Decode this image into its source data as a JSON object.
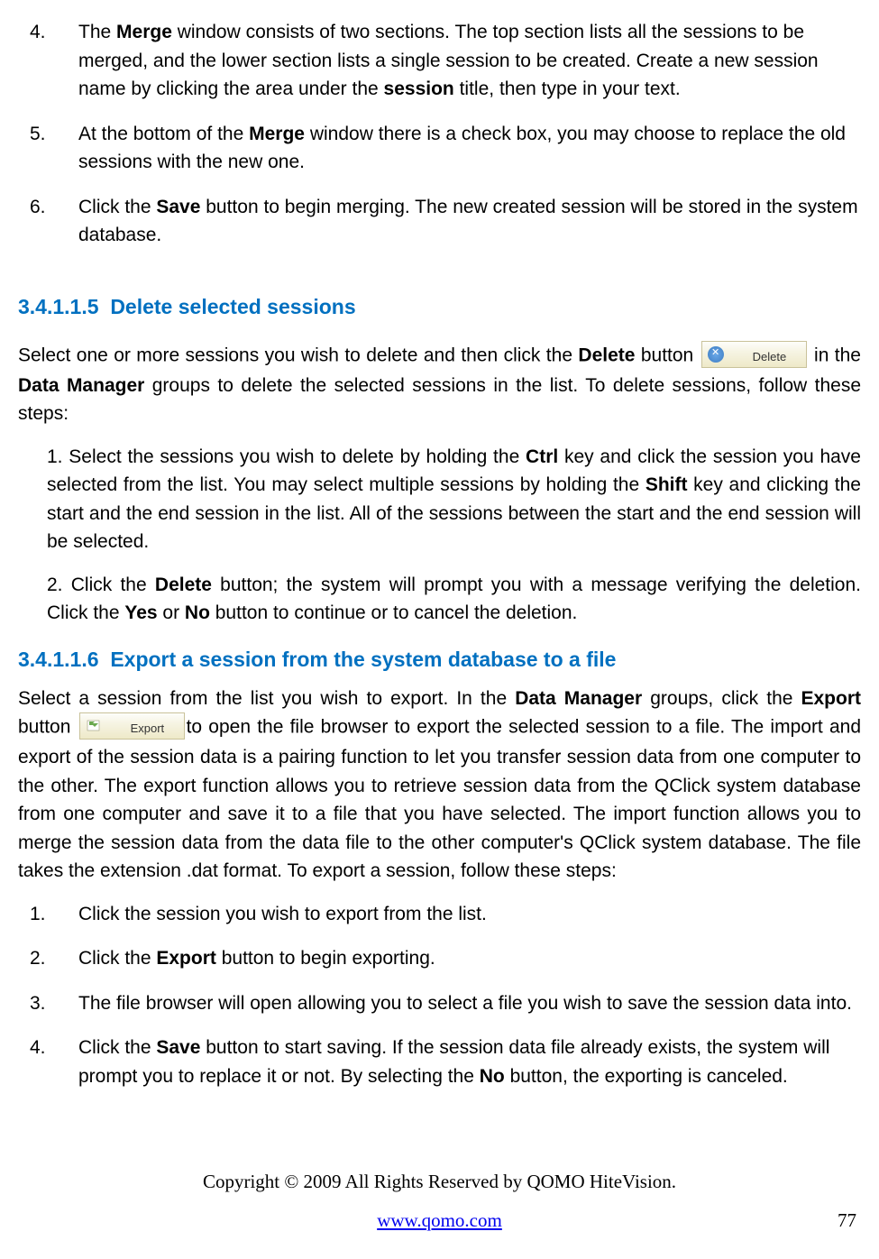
{
  "topList": {
    "items": [
      {
        "num": "4.",
        "pre": "The ",
        "bold1": "Merge",
        "mid": " window consists of two sections. The top section lists all the sessions to be merged, and the lower section lists a single session to be created. Create a new session name by clicking the area under the ",
        "bold2": "session",
        "post": " title, then type in your text."
      },
      {
        "num": "5.",
        "pre": "At the bottom of the ",
        "bold1": "Merge",
        "post": " window there is a check box, you may choose to replace the old sessions with the new one."
      },
      {
        "num": "6.",
        "pre": "Click the ",
        "bold1": "Save",
        "post": " button to begin merging. The new created session will be stored in the system database."
      }
    ]
  },
  "section1": {
    "num": "3.4.1.1.5",
    "title": "Delete selected sessions",
    "intro": {
      "pre": "Select one or more sessions you wish to delete and then click the ",
      "bold1": "Delete",
      "mid1": " button ",
      "btnLabel": "Delete",
      "mid2": " in the ",
      "bold2": "Data Manager",
      "post": " groups to delete the selected sessions in the list. To delete sessions, follow these steps:"
    },
    "step1": {
      "num": "1. ",
      "t1": "Select the sessions you wish to delete by holding the ",
      "b1": "Ctrl",
      "t2": " key and click the session you have selected from the list. You may select multiple sessions by holding the ",
      "b2": "Shift",
      "t3": " key and clicking the start and the end session in the list. All of the sessions between the start and the end session will be selected."
    },
    "step2": {
      "num": "2. ",
      "t1": "Click the ",
      "b1": "Delete",
      "t2": " button; the system will prompt you with a message verifying the deletion. Click the ",
      "b2": "Yes",
      "t3": " or ",
      "b3": "No",
      "t4": " button to continue or to cancel the deletion."
    }
  },
  "section2": {
    "num": "3.4.1.1.6",
    "title": "Export a session from the system database to a file",
    "intro": {
      "t1": "Select a session from the list you wish to export. In the ",
      "b1": "Data Manager",
      "t2": " groups, click the ",
      "b2": "Export",
      "t3": " button ",
      "btnLabel": "Export",
      "t4": "to open the file browser to export the selected session to a file. The import and export of the session data is a pairing function to let you transfer session data from one computer to the other. The export function allows you to retrieve session data from the QClick system database from one computer and save it to a file that you have selected. The import function allows you to merge the session data from the data file to the other computer's QClick system database. The file takes the extension .dat format. To export a session, follow these steps:"
    },
    "steps": [
      {
        "num": "1.",
        "text": "Click the session you wish to export from the list."
      },
      {
        "num": "2.",
        "pre": "Click the ",
        "b1": "Export",
        "post": " button to begin exporting."
      },
      {
        "num": "3.",
        "text": "The file browser will open allowing you to select a file you wish to save the session data into."
      },
      {
        "num": "4.",
        "pre": "Click the ",
        "b1": "Save",
        "mid": " button to start saving. If the session data file already exists, the system will prompt you to replace it or not. By selecting the ",
        "b2": "No",
        "post": " button, the exporting is canceled."
      }
    ]
  },
  "footer": {
    "copyright": "Copyright © 2009 All Rights Reserved by QOMO HiteVision.",
    "url": "www.qomo.com",
    "page": "77"
  }
}
